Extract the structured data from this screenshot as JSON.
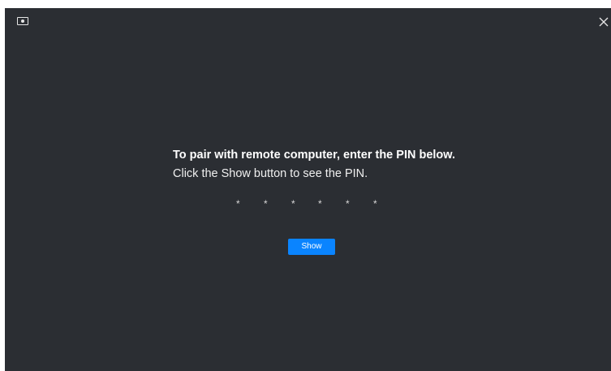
{
  "window": {
    "icon": "screen-icon",
    "close_icon": "close-icon"
  },
  "pairing": {
    "headline": "To pair with remote computer, enter the PIN below.",
    "instruction": "Click the Show button to see the PIN.",
    "pin_mask": [
      "*",
      "*",
      "*",
      "*",
      "*",
      "*"
    ],
    "show_label": "Show"
  },
  "colors": {
    "background": "#2b2e33",
    "accent": "#0a84ff",
    "text": "#ffffff"
  }
}
